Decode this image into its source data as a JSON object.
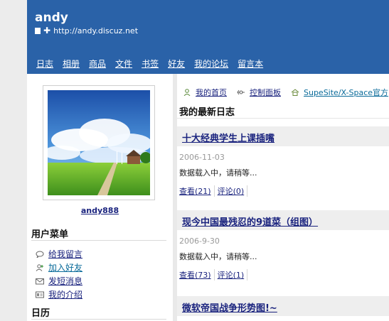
{
  "header": {
    "title": "andy",
    "url": "http://andy.discuz.net"
  },
  "nav": [
    "日志",
    "相册",
    "商品",
    "文件",
    "书签",
    "好友",
    "我的论坛",
    "留言本"
  ],
  "sidebar": {
    "username": "andy888",
    "menu_title": "用户菜单",
    "menu_items": [
      {
        "label": "给我留言",
        "icon": "speech-bubble-icon"
      },
      {
        "label": "加入好友",
        "icon": "add-friend-icon"
      },
      {
        "label": "发短消息",
        "icon": "envelope-icon"
      },
      {
        "label": "我的介绍",
        "icon": "id-card-icon"
      }
    ],
    "calendar_title": "日历"
  },
  "toplinks": [
    {
      "label": "我的首页",
      "icon": "person-icon"
    },
    {
      "label": "控制面板",
      "icon": "control-panel-icon"
    },
    {
      "label": "SupeSite/X-Space官方",
      "icon": "home-icon"
    }
  ],
  "section_title": "我的最新日志",
  "posts": [
    {
      "title": "十大经典学生上课插嘴",
      "date": "2006-11-03",
      "excerpt": "数据载入中，请稍等...",
      "views": "查看(21)",
      "comments": "评论(0)"
    },
    {
      "title": "现今中国最残忍的9道菜（组图）",
      "date": "2006-9-30",
      "excerpt": "数据载入中，请稍等...",
      "views": "查看(73)",
      "comments": "评论(1)"
    },
    {
      "title": "微软帝国战争形势图!~"
    }
  ],
  "colors": {
    "header_bg": "#2a62a8",
    "link": "#1a237e",
    "teal_link": "#0a6b9a"
  }
}
